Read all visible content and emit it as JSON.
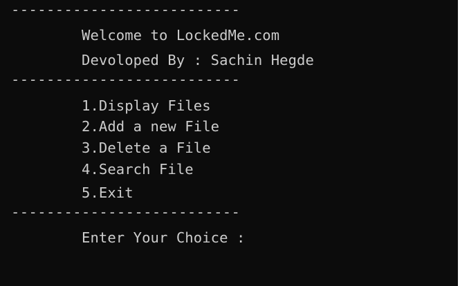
{
  "console": {
    "divider": "--------------------------",
    "welcome": "Welcome to LockedMe.com",
    "developer": "Devoloped By : Sachin Hegde",
    "menu": [
      "1.Display Files",
      "2.Add a new File",
      "3.Delete a File",
      "4.Search File",
      "5.Exit"
    ],
    "prompt": "Enter Your Choice :"
  },
  "colors": {
    "background": "#0c0c0c",
    "text": "#cccccc"
  }
}
